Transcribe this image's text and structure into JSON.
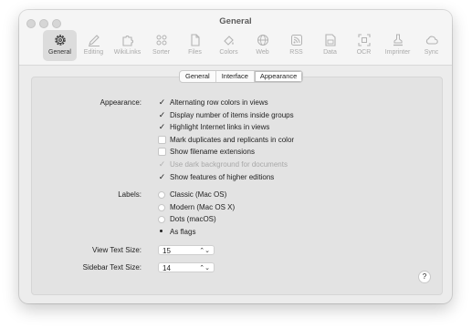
{
  "window": {
    "title": "General"
  },
  "toolbar": {
    "items": [
      {
        "label": "General",
        "icon": "gear-icon"
      },
      {
        "label": "Editing",
        "icon": "pencil-icon"
      },
      {
        "label": "WikiLinks",
        "icon": "puzzle-icon"
      },
      {
        "label": "Sorter",
        "icon": "sorter-icon"
      },
      {
        "label": "Files",
        "icon": "file-icon"
      },
      {
        "label": "Colors",
        "icon": "paint-icon"
      },
      {
        "label": "Web",
        "icon": "globe-icon"
      },
      {
        "label": "RSS",
        "icon": "rss-icon"
      },
      {
        "label": "Data",
        "icon": "data-icon"
      },
      {
        "label": "OCR",
        "icon": "ocr-icon"
      },
      {
        "label": "Imprinter",
        "icon": "stamp-icon"
      },
      {
        "label": "Sync",
        "icon": "cloud-icon"
      }
    ]
  },
  "tabs": [
    "General",
    "Interface",
    "Appearance"
  ],
  "appearance": {
    "label": "Appearance:",
    "options": [
      {
        "label": "Alternating row colors in views",
        "checked": true
      },
      {
        "label": "Display number of items inside groups",
        "checked": true
      },
      {
        "label": "Highlight Internet links in views",
        "checked": true
      },
      {
        "label": "Mark duplicates and replicants in color",
        "checked": false
      },
      {
        "label": "Show filename extensions",
        "checked": false
      },
      {
        "label": "Use dark background for documents",
        "checked": true,
        "disabled": true
      },
      {
        "label": "Show features of higher editions",
        "checked": true
      }
    ]
  },
  "labels": {
    "label": "Labels:",
    "options": [
      "Classic (Mac OS)",
      "Modern (Mac OS X)",
      "Dots (macOS)",
      "As flags"
    ],
    "selected": "As flags"
  },
  "view_text_size": {
    "label": "View Text Size:",
    "value": "15"
  },
  "sidebar_text_size": {
    "label": "Sidebar Text Size:",
    "value": "14"
  },
  "help": {
    "label": "?"
  }
}
